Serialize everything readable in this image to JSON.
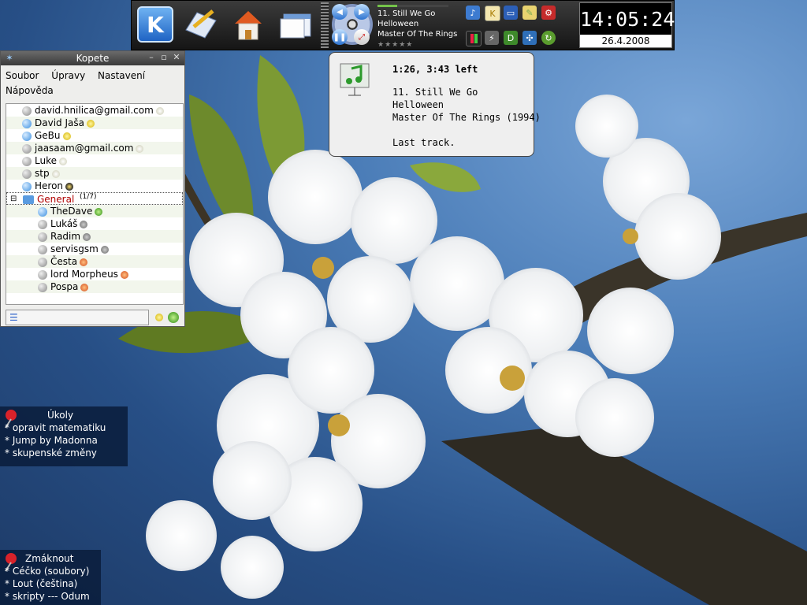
{
  "panel": {
    "launchers": [
      {
        "icon": "kde-menu-icon"
      },
      {
        "icon": "text-editor-icon"
      },
      {
        "icon": "home-folder-icon"
      },
      {
        "icon": "window-list-icon"
      }
    ],
    "player": {
      "track": "11. Still We Go",
      "artist": "Helloween",
      "album": "Master Of The Rings",
      "progress": 0.28,
      "rating_stars": "★★★★★"
    },
    "tray_icons": [
      "volume-icon",
      "klipper-icon",
      "display-icon",
      "notes-icon",
      "network-icon",
      "battery-icon",
      "plug-icon",
      "kdict-icon",
      "network-monitor-icon",
      "update-icon"
    ],
    "clock": {
      "time": "14:05:24",
      "date": "26.4.2008"
    }
  },
  "kopete": {
    "title": "Kopete",
    "menu": [
      "Soubor",
      "Úpravy",
      "Nastavení",
      "Nápověda"
    ],
    "contacts": [
      {
        "name": "david.hnilica@gmail.com",
        "status": "bulboff",
        "online": false
      },
      {
        "name": "David Jaša",
        "status": "bulb",
        "online": true
      },
      {
        "name": "GeBu",
        "status": "bulb",
        "online": true
      },
      {
        "name": "jaasaam@gmail.com",
        "status": "bulboff",
        "online": false
      },
      {
        "name": "Luke",
        "status": "bulboff",
        "online": false
      },
      {
        "name": "stp",
        "status": "bulboff",
        "online": false
      },
      {
        "name": "Heron",
        "status": "away",
        "online": true
      }
    ],
    "group": {
      "name": "General",
      "count": "(1/7)"
    },
    "group_contacts": [
      {
        "name": "TheDave",
        "status": "green",
        "online": true
      },
      {
        "name": "Lukáš",
        "status": "grey",
        "online": false
      },
      {
        "name": "Radim",
        "status": "grey",
        "online": false
      },
      {
        "name": "servisgsm",
        "status": "grey",
        "online": false
      },
      {
        "name": "Česta",
        "status": "orange",
        "online": false
      },
      {
        "name": "lord Morpheus",
        "status": "orange",
        "online": false
      },
      {
        "name": "Pospa",
        "status": "orange",
        "online": false
      }
    ]
  },
  "popup": {
    "time": "1:26, 3:43 left",
    "track": "11. Still We Go",
    "artist": "Helloween",
    "album": "Master Of The Rings (1994)",
    "note": "Last track."
  },
  "notes": [
    {
      "title": "Úkoly",
      "items": [
        "* opravit matematiku",
        "* Jump by Madonna",
        "* skupenské změny"
      ]
    },
    {
      "title": "Zmáknout",
      "items": [
        "* Céčko (soubory)",
        "* Lout (čeština)",
        "* skripty --- Odum"
      ]
    }
  ],
  "colors": {
    "accent": "#3a8ee0",
    "group_name": "#b00000",
    "panel_bg": "#1e1e1e"
  }
}
